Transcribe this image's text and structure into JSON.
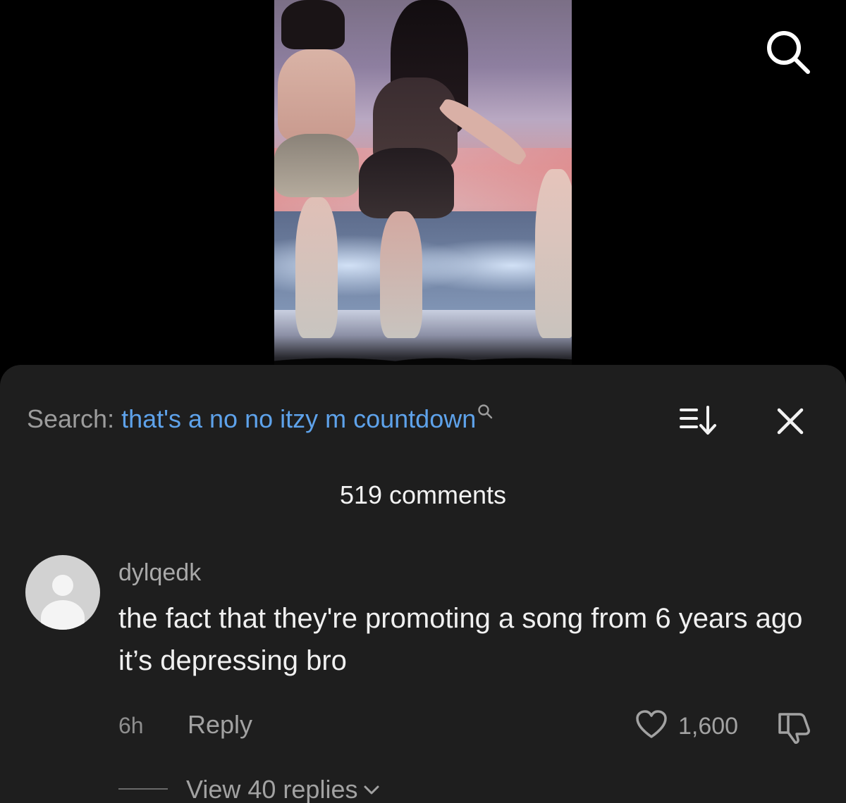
{
  "colors": {
    "sheet_background": "#1e1e1e",
    "search_query": "#5ea2ea",
    "muted_text": "#a2a2a2"
  },
  "video": {
    "search_icon": "search-icon"
  },
  "comments_panel": {
    "search_prefix": "Search:",
    "search_query": "that's a no no itzy m countdown",
    "sort_icon": "sort-icon",
    "close_icon": "close-icon",
    "comment_count": "519 comments"
  },
  "comments": [
    {
      "username": "dylqedk",
      "text": "the fact that they're promoting a song from 6 years ago it’s depressing bro",
      "time": "6h",
      "reply_label": "Reply",
      "likes": "1,600",
      "view_replies_label": "View 40 replies"
    }
  ]
}
